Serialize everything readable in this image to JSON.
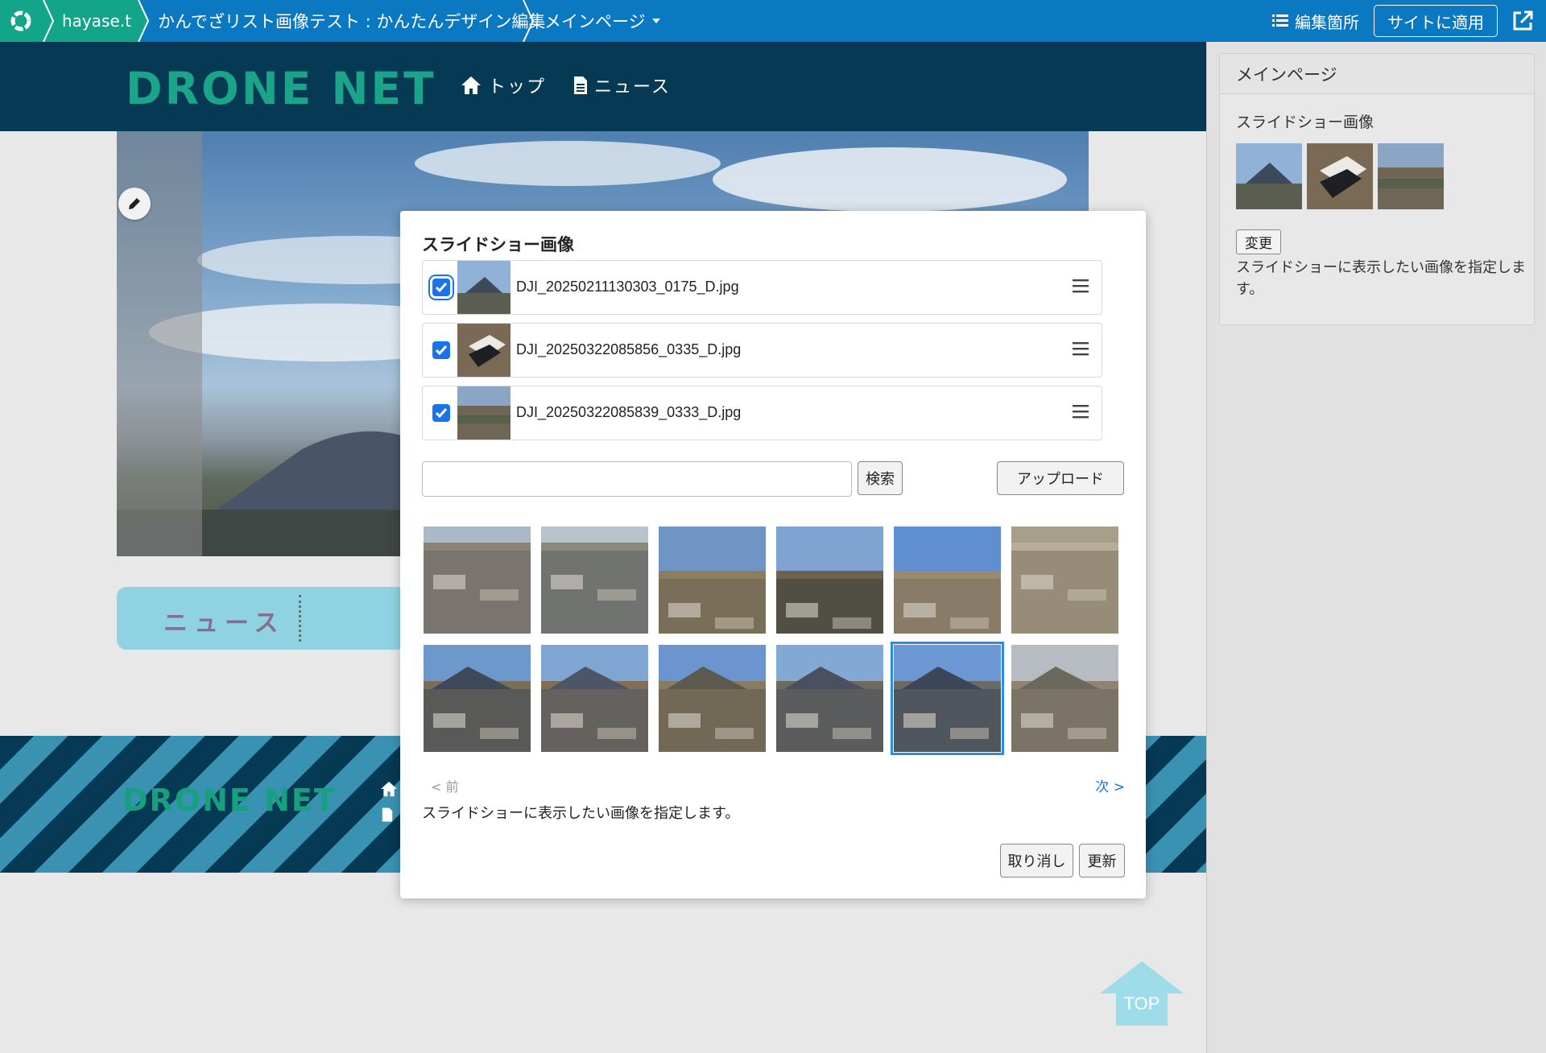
{
  "topbar": {
    "site_name": "hayase.tv",
    "page_crumb": "かんでざリスト画像テスト : かんたんデザイン編集",
    "menu_crumb": "メインページ",
    "edit_places_label": "編集箇所",
    "apply_label": "サイトに適用"
  },
  "site": {
    "logo": "DRONE NET",
    "nav": [
      {
        "label": "トップ",
        "icon": "home-icon"
      },
      {
        "label": "ニュース",
        "icon": "document-icon"
      }
    ],
    "news_tab_label": "ニュース",
    "footer_logo": "DRONE NET",
    "top_button_label": "TOP"
  },
  "modal": {
    "title": "スライドショー画像",
    "selected": [
      {
        "filename": "DJI_20250211130303_0175_D.jpg",
        "checked": true
      },
      {
        "filename": "DJI_20250322085856_0335_D.jpg",
        "checked": true
      },
      {
        "filename": "DJI_20250322085839_0333_D.jpg",
        "checked": true
      }
    ],
    "search_placeholder": "",
    "search_label": "検索",
    "upload_label": "アップロード",
    "gallery_count": 12,
    "selected_gallery_index": 10,
    "prev_label": "< 前",
    "next_label": "次 >",
    "help_text": "スライドショーに表示したい画像を指定します。",
    "cancel_label": "取り消し",
    "update_label": "更新"
  },
  "panel": {
    "title": "メインページ",
    "field_label": "スライドショー画像",
    "change_label": "変更",
    "help_text": "スライドショーに表示したい画像を指定します。"
  },
  "colors": {
    "topbar": "#0b78c2",
    "topbar_green": "#12a58a",
    "site_header": "#053954",
    "logo_green": "#1aa48a",
    "checkbox": "#1a73e8",
    "link_blue": "#1a73c8"
  }
}
